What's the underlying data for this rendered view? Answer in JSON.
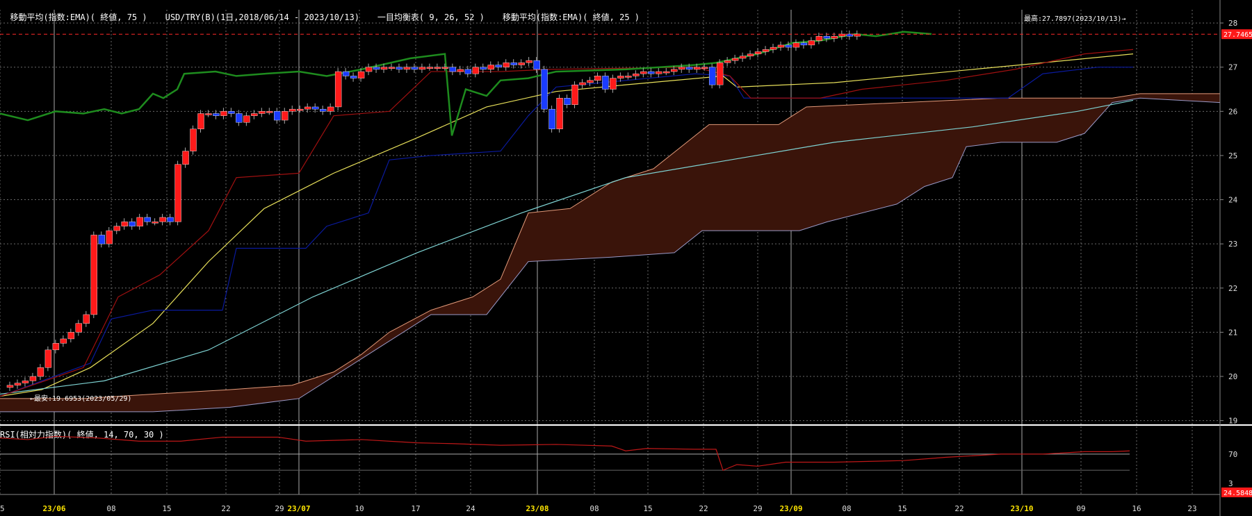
{
  "legend": {
    "ema75": "移動平均(指数:EMA)( 終値, 75 )",
    "symbol": "USD/TRY(B)(1日,2018/06/14 - 2023/10/13)",
    "ichimoku": "一目均衡表( 9, 26, 52 )",
    "ema25": "移動平均(指数:EMA)( 終値, 25 )"
  },
  "rsi_legend": "RSI(相対力指数)( 終値, 14, 70, 30 )",
  "colors": {
    "up": "#ff1a1a",
    "down": "#1a3cff",
    "ema75": "#7fd4d4",
    "ema25": "#e8e05a",
    "kijun": "#0a1a9e",
    "tenkan": "#a01010",
    "chikou": "#1e8c1e",
    "cloud": "#3a140a",
    "spanA": "#e39a7a",
    "spanB": "#9a9ac8",
    "grid": "#6a6a6a",
    "price_line": "#ff2a2a"
  },
  "chart_data": {
    "type": "candlestick",
    "x_labels": [
      "25",
      "23/06",
      "08",
      "15",
      "22",
      "29",
      "23/07",
      "10",
      "17",
      "24",
      "23/08",
      "08",
      "15",
      "22",
      "29",
      "23/09",
      "08",
      "15",
      "22",
      "23/10",
      "09",
      "16",
      "23"
    ],
    "x_label_highlight": [
      "23/06",
      "23/07",
      "23/08",
      "23/09",
      "23/10"
    ],
    "y_ticks": [
      "19",
      "20",
      "21",
      "22",
      "23",
      "24",
      "25",
      "26",
      "27",
      "28"
    ],
    "ylim": [
      18.9,
      28.3
    ],
    "last_price": "27.7465",
    "high_annotation": "最高:27.7897(2023/10/13)→",
    "low_annotation": "←最安:19.6953(2023/05/29)",
    "rsi": {
      "ylim": [
        20,
        100
      ],
      "levels": [
        "70"
      ],
      "label_box": "24.5848",
      "bottom_tick": "3"
    }
  }
}
